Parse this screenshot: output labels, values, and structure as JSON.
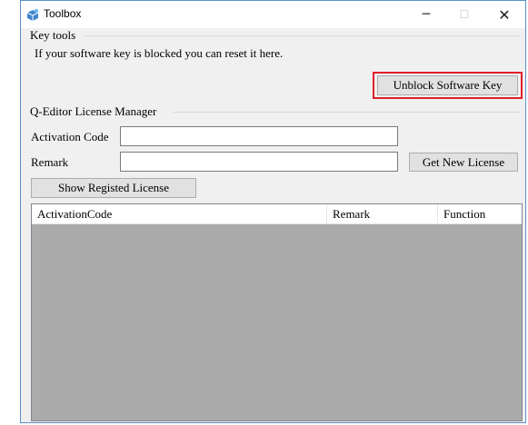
{
  "window": {
    "title": "Toolbox",
    "controls": {
      "minimize": "─",
      "maximize": "☐",
      "close": "✕"
    }
  },
  "key_tools": {
    "group_label": "Key tools",
    "description": "If your software key is blocked you can reset it here.",
    "unblock_button": "Unblock Software Key"
  },
  "license_manager": {
    "group_label": "Q-Editor License Manager",
    "activation_code_label": "Activation Code",
    "activation_code_value": "",
    "remark_label": "Remark",
    "remark_value": "",
    "get_license_button": "Get New License",
    "show_registered_button": "Show Registed License"
  },
  "grid": {
    "columns": [
      "ActivationCode",
      "Remark",
      "Function"
    ],
    "rows": []
  },
  "colors": {
    "highlight": "#e0202a",
    "grid_background": "#ababab",
    "window_border": "#5b8fc9"
  }
}
